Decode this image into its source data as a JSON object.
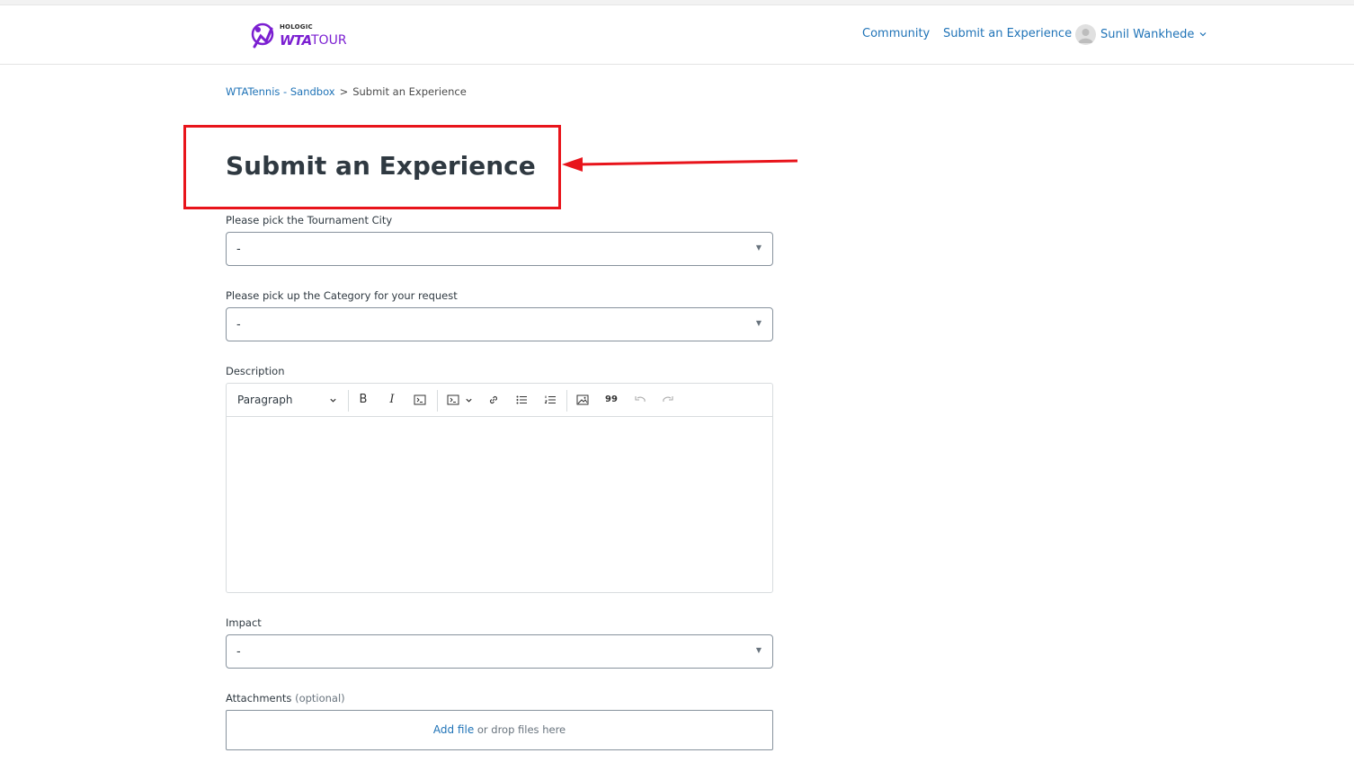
{
  "header": {
    "logo": {
      "brand_small": "HOLOGIC",
      "brand_wta": "WTA",
      "brand_tour": "TOUR"
    },
    "nav": {
      "community": "Community",
      "submit": "Submit an Experience"
    },
    "user": {
      "name": "Sunil Wankhede"
    }
  },
  "breadcrumb": {
    "items": [
      "WTATennis - Sandbox",
      "Submit an Experience"
    ],
    "separator": ">"
  },
  "page": {
    "title": "Submit an Experience"
  },
  "form": {
    "tournament_city": {
      "label": "Please pick the Tournament City",
      "value": "-"
    },
    "category": {
      "label": "Please pick up the Category for your request",
      "value": "-"
    },
    "description": {
      "label": "Description",
      "toolbar": {
        "block_format": "Paragraph",
        "bold": "B",
        "italic": "I",
        "quote": "99"
      }
    },
    "impact": {
      "label": "Impact",
      "value": "-"
    },
    "attachments": {
      "label": "Attachments",
      "optional": "(optional)",
      "add_file": "Add file",
      "drop_text": "or drop files here"
    }
  },
  "colors": {
    "link": "#1f73b7",
    "annotation": "#e8141b",
    "brand": "#7b1fd1"
  }
}
